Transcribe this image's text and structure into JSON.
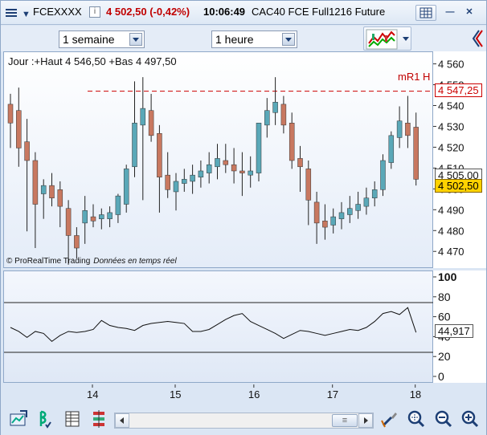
{
  "titlebar": {
    "symbol": "FCEXXXX",
    "info_label": "i",
    "price_change": "4 502,50 (-0,42%)",
    "time": "10:06:49",
    "instrument": "CAC40 FCE Full1216 Future",
    "minimize_label": "—",
    "close_label": "✕"
  },
  "toolbar": {
    "period_value": "1 semaine",
    "interval_value": "1 heure"
  },
  "price_chart": {
    "high_low_text": "Jour :+Haut 4 546,50 +Bas 4 497,50",
    "copyright": "© ProRealTime Trading",
    "realtime_note": "Données en temps réel",
    "mr1_label": "mR1 H",
    "mr1_value": "4 547,25",
    "tag_upper": "4 505,00",
    "tag_last": "4 502,50",
    "colors": {
      "up": "#5aa8b8",
      "down": "#c87860",
      "mr1": "#cc0000",
      "last_bg": "#ffd200"
    }
  },
  "indicator": {
    "value_label": "44,917",
    "overbought": 75,
    "oversold": 25
  },
  "chart_data": [
    {
      "type": "candlestick",
      "title": "",
      "ylim": [
        4462,
        4566
      ],
      "y_ticks": [
        "4 560",
        "4 550",
        "4 540",
        "4 530",
        "4 520",
        "4 510",
        "4 500",
        "4 490",
        "4 480",
        "4 470"
      ],
      "x_ticks": [
        "14",
        "15",
        "16",
        "17",
        "18"
      ],
      "reference_line": {
        "name": "mR1 H",
        "value": 4547.25
      },
      "candles": [
        [
          4541,
          4546,
          4520,
          4532
        ],
        [
          4538,
          4549,
          4511,
          4520
        ],
        [
          4523,
          4534,
          4480,
          4514
        ],
        [
          4514,
          4518,
          4472,
          4493
        ],
        [
          4498,
          4505,
          4486,
          4502
        ],
        [
          4502,
          4508,
          4492,
          4496
        ],
        [
          4500,
          4504,
          4482,
          4492
        ],
        [
          4491,
          4495,
          4464,
          4478
        ],
        [
          4478,
          4482,
          4467,
          4472
        ],
        [
          4484,
          4497,
          4474,
          4490
        ],
        [
          4487,
          4493,
          4482,
          4485
        ],
        [
          4486,
          4491,
          4481,
          4488
        ],
        [
          4486,
          4492,
          4482,
          4489
        ],
        [
          4488,
          4498,
          4484,
          4497
        ],
        [
          4493,
          4512,
          4489,
          4510
        ],
        [
          4511,
          4552,
          4506,
          4532
        ],
        [
          4531,
          4554,
          4495,
          4539
        ],
        [
          4538,
          4546,
          4523,
          4526
        ],
        [
          4527,
          4531,
          4489,
          4506
        ],
        [
          4507,
          4518,
          4496,
          4500
        ],
        [
          4499,
          4508,
          4490,
          4504
        ],
        [
          4503,
          4510,
          4499,
          4505
        ],
        [
          4504,
          4512,
          4498,
          4507
        ],
        [
          4506,
          4514,
          4501,
          4509
        ],
        [
          4508,
          4518,
          4503,
          4512
        ],
        [
          4511,
          4522,
          4505,
          4515
        ],
        [
          4514,
          4522,
          4508,
          4512
        ],
        [
          4512,
          4520,
          4503,
          4509
        ],
        [
          4509,
          4518,
          4497,
          4508
        ],
        [
          4507,
          4516,
          4501,
          4509
        ],
        [
          4508,
          4532,
          4504,
          4532
        ],
        [
          4531,
          4544,
          4525,
          4538
        ],
        [
          4537,
          4554,
          4531,
          4542
        ],
        [
          4541,
          4545,
          4527,
          4531
        ],
        [
          4532,
          4537,
          4510,
          4514
        ],
        [
          4515,
          4521,
          4499,
          4511
        ],
        [
          4510,
          4514,
          4483,
          4495
        ],
        [
          4494,
          4499,
          4474,
          4484
        ],
        [
          4485,
          4493,
          4476,
          4482
        ],
        [
          4483,
          4491,
          4479,
          4487
        ],
        [
          4486,
          4494,
          4481,
          4489
        ],
        [
          4488,
          4497,
          4484,
          4491
        ],
        [
          4490,
          4499,
          4486,
          4493
        ],
        [
          4492,
          4501,
          4488,
          4496
        ],
        [
          4496,
          4504,
          4492,
          4500
        ],
        [
          4500,
          4517,
          4497,
          4514
        ],
        [
          4513,
          4528,
          4510,
          4526
        ],
        [
          4525,
          4540,
          4520,
          4533
        ],
        [
          4532,
          4545,
          4520,
          4526
        ],
        [
          4530,
          4537,
          4502,
          4505
        ]
      ]
    },
    {
      "type": "line",
      "title": "",
      "ylim": [
        0,
        100
      ],
      "y_ticks": [
        "100",
        "80",
        "60",
        "40",
        "20",
        "0"
      ],
      "values": [
        50,
        46,
        40,
        46,
        44,
        36,
        42,
        46,
        45,
        46,
        48,
        57,
        52,
        50,
        49,
        47,
        52,
        54,
        55,
        56,
        55,
        54,
        46,
        46,
        48,
        53,
        58,
        62,
        64,
        56,
        52,
        48,
        44,
        39,
        43,
        47,
        46,
        44,
        42,
        44,
        46,
        48,
        47,
        50,
        56,
        64,
        66,
        63,
        70,
        45
      ]
    }
  ],
  "bottombar": {
    "scroll_mid_glyph": "≡"
  }
}
